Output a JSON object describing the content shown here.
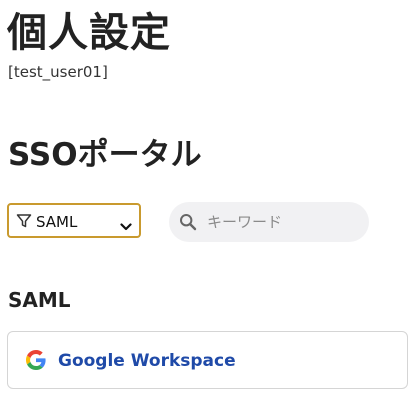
{
  "header": {
    "title": "個人設定",
    "user_id": "[test_user01]"
  },
  "portal": {
    "title": "SSOポータル",
    "filter": {
      "icon": "filter-icon",
      "selected": "SAML"
    },
    "search": {
      "icon": "search-icon",
      "placeholder": "キーワード",
      "value": ""
    },
    "groups": [
      {
        "title": "SAML",
        "apps": [
          {
            "name": "Google Workspace",
            "icon": "google-icon"
          }
        ]
      }
    ]
  },
  "colors": {
    "filter_border": "#c99a2e",
    "search_bg": "#f1f1f3",
    "app_link": "#1f4aa8",
    "card_border": "#d5d5d5"
  }
}
